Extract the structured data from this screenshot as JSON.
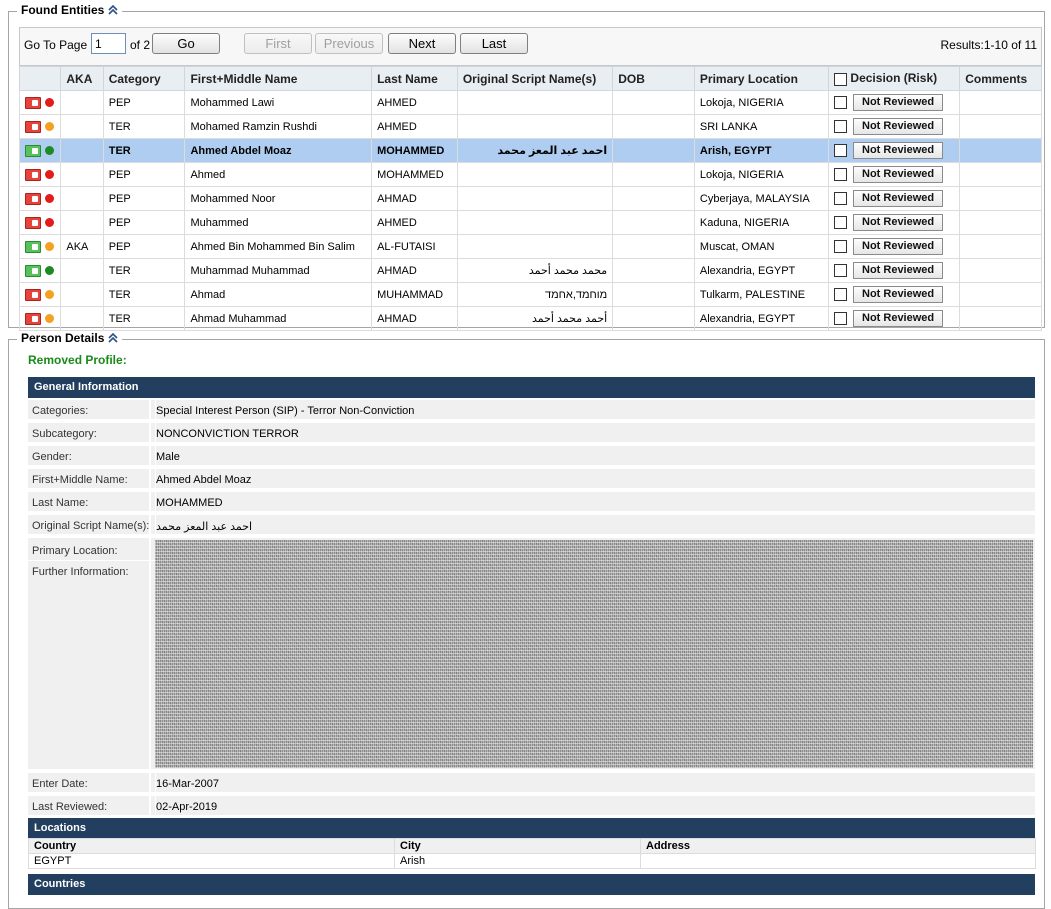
{
  "found_entities": {
    "title": "Found Entities",
    "pager": {
      "go_to_page_label": "Go To Page",
      "page_value": "1",
      "of_label": "of 2",
      "go": "Go",
      "first": "First",
      "previous": "Previous",
      "next": "Next",
      "last": "Last",
      "results": "Results:1-10 of 11"
    },
    "columns": [
      "",
      "AKA",
      "Category",
      "First+Middle Name",
      "Last Name",
      "Original Script Name(s)",
      "DOB",
      "Primary Location",
      "Decision (Risk)",
      "Comments"
    ],
    "decision_label": "Not Reviewed",
    "rows": [
      {
        "flag": "red",
        "dot": "red",
        "aka": "",
        "category": "PEP",
        "first": "Mohammed Lawi",
        "last": "AHMED",
        "script": "",
        "dob": "",
        "location": "Lokoja, NIGERIA",
        "selected": false
      },
      {
        "flag": "red",
        "dot": "orange",
        "aka": "",
        "category": "TER",
        "first": "Mohamed Ramzin Rushdi",
        "last": "AHMED",
        "script": "",
        "dob": "",
        "location": "SRI LANKA",
        "selected": false
      },
      {
        "flag": "green",
        "dot": "green",
        "aka": "",
        "category": "TER",
        "first": "Ahmed Abdel Moaz",
        "last": "MOHAMMED",
        "script": "احمد عبد المعز محمد",
        "dob": "",
        "location": "Arish, EGYPT",
        "selected": true
      },
      {
        "flag": "red",
        "dot": "red",
        "aka": "",
        "category": "PEP",
        "first": "Ahmed",
        "last": "MOHAMMED",
        "script": "",
        "dob": "",
        "location": "Lokoja, NIGERIA",
        "selected": false
      },
      {
        "flag": "red",
        "dot": "red",
        "aka": "",
        "category": "PEP",
        "first": "Mohammed Noor",
        "last": "AHMAD",
        "script": "",
        "dob": "",
        "location": "Cyberjaya, MALAYSIA",
        "selected": false
      },
      {
        "flag": "red",
        "dot": "red",
        "aka": "",
        "category": "PEP",
        "first": "Muhammed",
        "last": "AHMED",
        "script": "",
        "dob": "",
        "location": "Kaduna, NIGERIA",
        "selected": false
      },
      {
        "flag": "green",
        "dot": "orange",
        "aka": "AKA",
        "category": "PEP",
        "first": "Ahmed Bin Mohammed Bin Salim",
        "last": "AL-FUTAISI",
        "script": "",
        "dob": "",
        "location": "Muscat, OMAN",
        "selected": false
      },
      {
        "flag": "green",
        "dot": "green",
        "aka": "",
        "category": "TER",
        "first": "Muhammad Muhammad",
        "last": "AHMAD",
        "script": "محمد محمد أحمد",
        "dob": "",
        "location": "Alexandria, EGYPT",
        "selected": false
      },
      {
        "flag": "red",
        "dot": "orange",
        "aka": "",
        "category": "TER",
        "first": "Ahmad",
        "last": "MUHAMMAD",
        "script": "מוחמד,אחמד",
        "dob": "",
        "location": "Tulkarm, PALESTINE",
        "selected": false
      },
      {
        "flag": "red",
        "dot": "orange",
        "aka": "",
        "category": "TER",
        "first": "Ahmad Muhammad",
        "last": "AHMAD",
        "script": "أحمد محمد أحمد",
        "dob": "",
        "location": "Alexandria, EGYPT",
        "selected": false
      }
    ]
  },
  "person_details": {
    "title": "Person Details",
    "removed_profile": "Removed Profile:",
    "general_info_title": "General Information",
    "fields": {
      "categories": {
        "label": "Categories:",
        "value": "Special Interest Person (SIP) - Terror Non-Conviction"
      },
      "subcategory": {
        "label": "Subcategory:",
        "value": "NONCONVICTION TERROR"
      },
      "gender": {
        "label": "Gender:",
        "value": "Male"
      },
      "first_middle": {
        "label": "First+Middle Name:",
        "value": "Ahmed Abdel Moaz"
      },
      "last_name": {
        "label": "Last Name:",
        "value": "MOHAMMED"
      },
      "original_script": {
        "label": "Original Script Name(s):",
        "value": "احمد عبد المعز محمد"
      },
      "primary_location": {
        "label": "Primary Location:"
      },
      "further_info": {
        "label": "Further Information:"
      },
      "enter_date": {
        "label": "Enter Date:",
        "value": "16-Mar-2007"
      },
      "last_reviewed": {
        "label": "Last Reviewed:",
        "value": "02-Apr-2019"
      }
    },
    "locations": {
      "title": "Locations",
      "columns": [
        "Country",
        "City",
        "Address"
      ],
      "rows": [
        {
          "country": "EGYPT",
          "city": "Arish",
          "address": ""
        }
      ]
    },
    "countries_title": "Countries"
  }
}
